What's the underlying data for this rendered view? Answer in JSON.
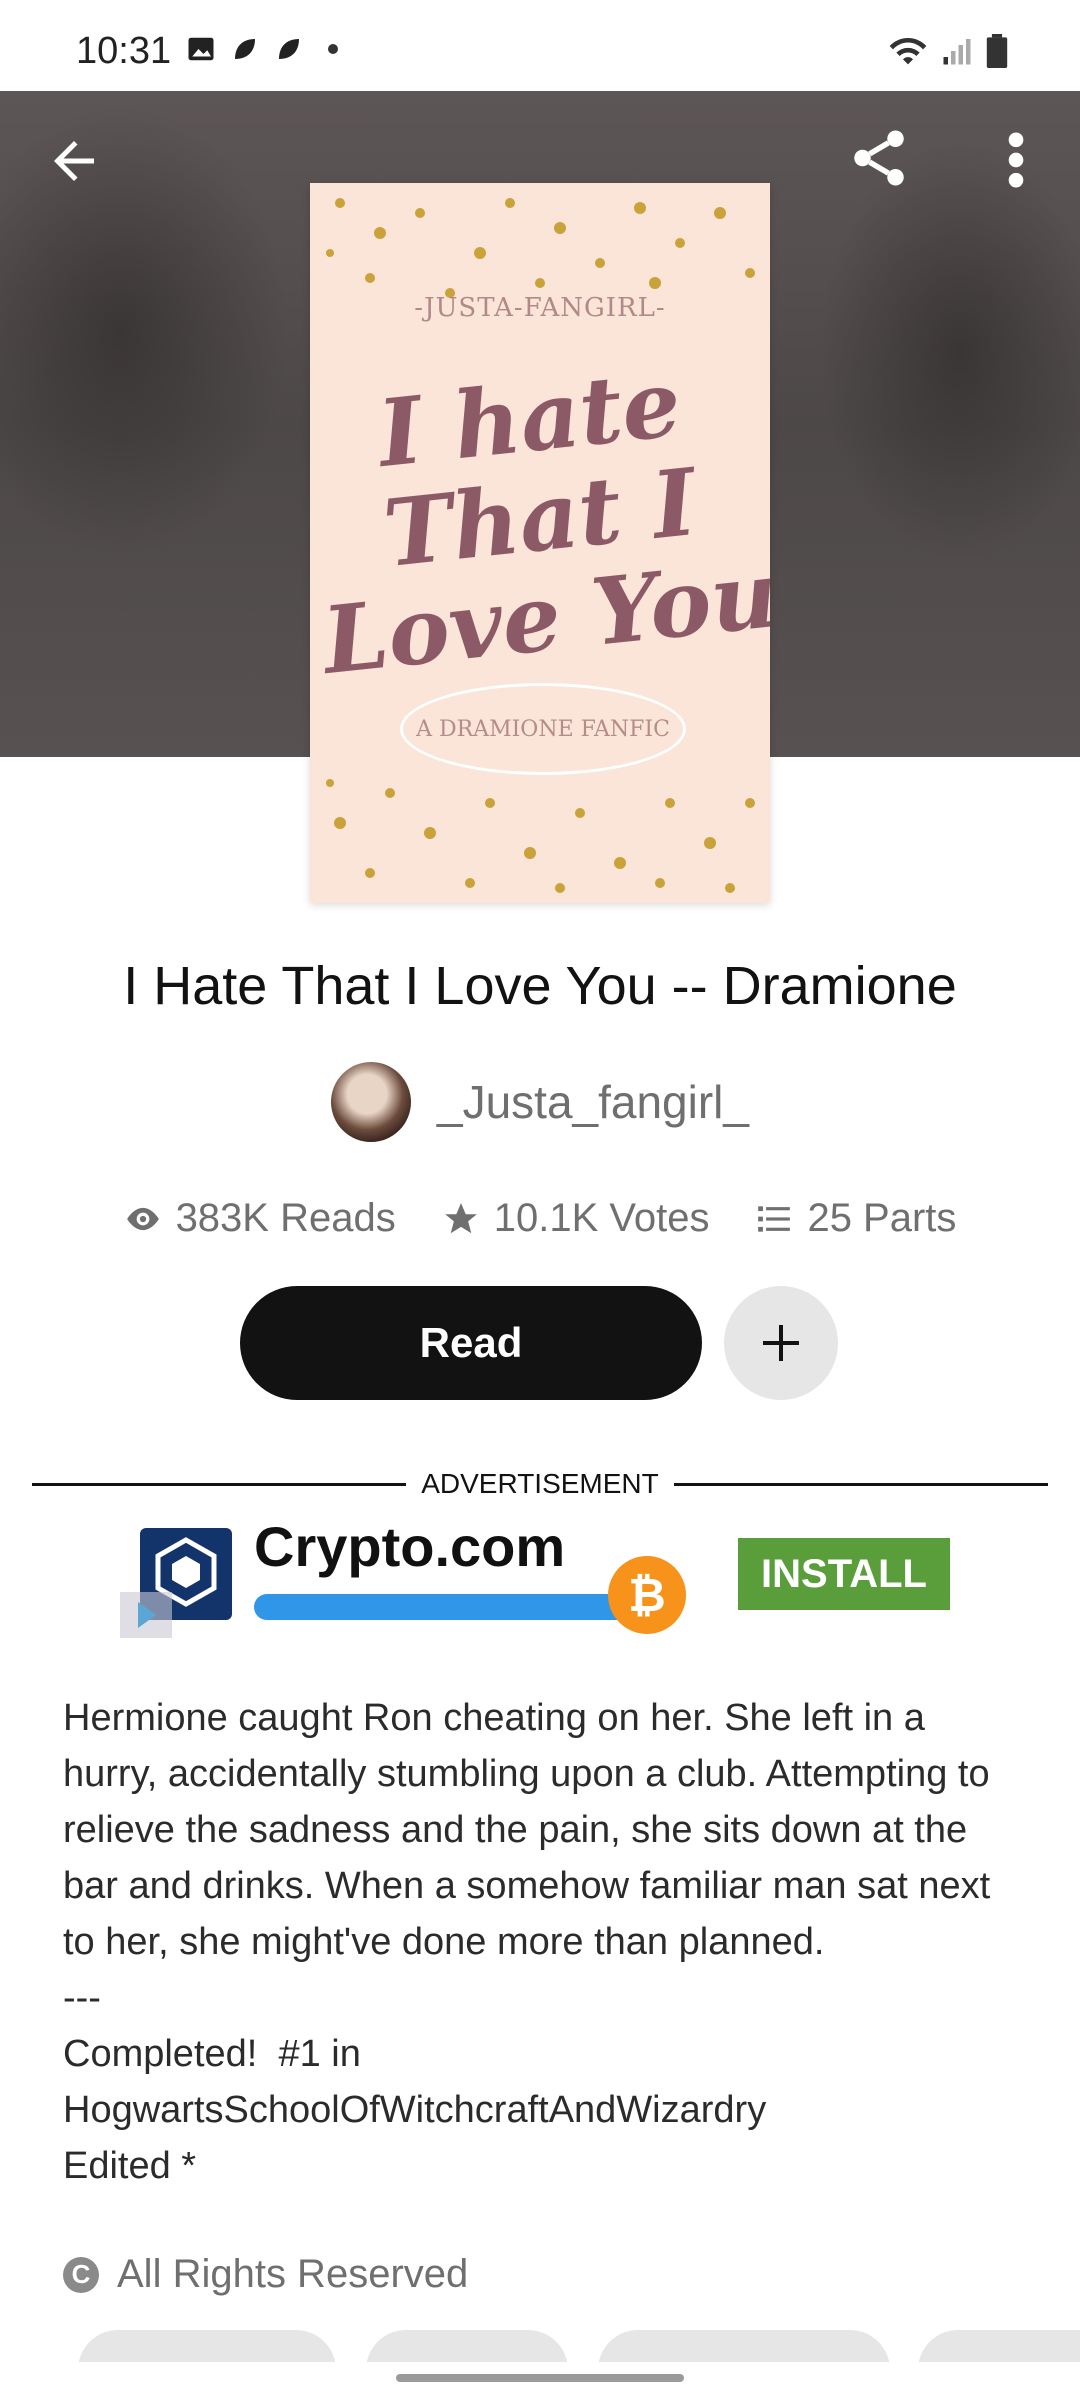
{
  "status_bar": {
    "time": "10:31"
  },
  "header": {
    "back_icon": "arrow-left-icon",
    "share_icon": "share-icon",
    "more_icon": "more-vertical-icon"
  },
  "cover": {
    "author_text": "-JUSTA-FANGIRL-",
    "title_text": "I hate That I Love You",
    "subtitle_text": "A DRAMIONE FANFIC"
  },
  "book": {
    "title": "I Hate That I Love You -- Dramione",
    "author": "_Justa_fangirl_",
    "stats": {
      "reads": "383K Reads",
      "votes": "10.1K Votes",
      "parts": "25 Parts"
    },
    "read_label": "Read"
  },
  "ad": {
    "label": "ADVERTISEMENT",
    "brand": "Crypto.com",
    "bitcoin_symbol": "₿",
    "install_label": "INSTALL"
  },
  "description": "Hermione caught Ron cheating on her. She left in a hurry, accidentally stumbling upon a club. Attempting to  relieve the sadness and the pain, she sits down at the bar and drinks. When a somehow familiar man sat next to her, she might've done more than planned.\n---\nCompleted!  #1 in HogwartsSchoolOfWitchcraftAndWizardry\nEdited *",
  "rights": {
    "icon_glyph": "C",
    "text": "All Rights Reserved"
  },
  "colors": {
    "read_button": "#121212",
    "install_button": "#5a9e3c",
    "btc": "#f7931a"
  }
}
